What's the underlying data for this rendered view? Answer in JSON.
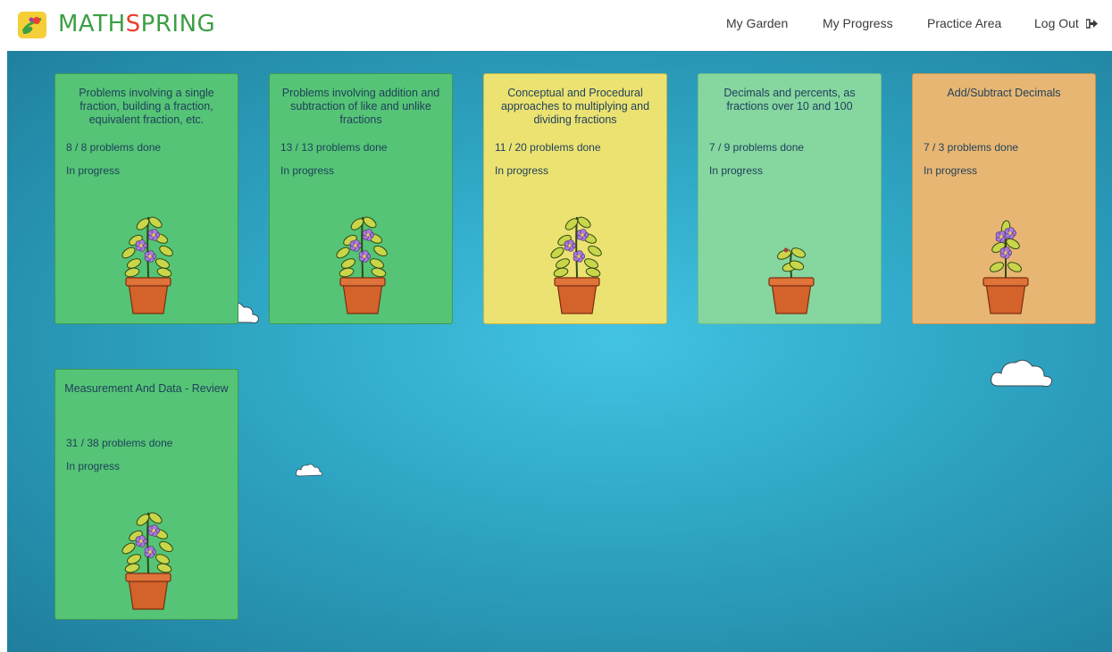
{
  "header": {
    "brand_part1": "MATH",
    "brand_part2": "S",
    "brand_part3": "PRING",
    "nav": {
      "my_garden": "My Garden",
      "my_progress": "My Progress",
      "practice_area": "Practice Area",
      "log_out": "Log Out"
    }
  },
  "colors": {
    "card_green": "#55c476",
    "card_yellow": "#ece272",
    "card_light_green": "#86d6a0",
    "card_orange": "#e8b673",
    "sky": "#2fa8c6"
  },
  "cards": [
    {
      "title": "Problems involving a single fraction, building a fraction, equivalent fraction, etc.",
      "count": "8 / 8 problems done",
      "status": "In progress",
      "color": "#55c476",
      "plant": "flowering"
    },
    {
      "title": "Problems involving addition and subtraction of like and unlike fractions",
      "count": "13 / 13 problems done",
      "status": "In progress",
      "color": "#55c476",
      "plant": "flowering"
    },
    {
      "title": "Conceptual and Procedural approaches to multiplying and dividing fractions",
      "count": "11 / 20 problems done",
      "status": "In progress",
      "color": "#ece272",
      "plant": "flowering"
    },
    {
      "title": "Decimals and percents, as fractions over 10 and 100",
      "count": "7 / 9 problems done",
      "status": "In progress",
      "color": "#86d6a0",
      "plant": "sprout"
    },
    {
      "title": "Add/Subtract Decimals",
      "count": "7 / 3 problems done",
      "status": "In progress",
      "color": "#e8b673",
      "plant": "small-flowering"
    },
    {
      "title": "Measurement And Data - Review",
      "count": "31 / 38 problems done",
      "status": "In progress",
      "color": "#55c476",
      "plant": "flowering"
    }
  ],
  "icons": {
    "logo": "mathspring-logo-icon",
    "logout": "logout-icon",
    "plant": "potted-plant-icon",
    "cloud": "cloud-icon"
  }
}
